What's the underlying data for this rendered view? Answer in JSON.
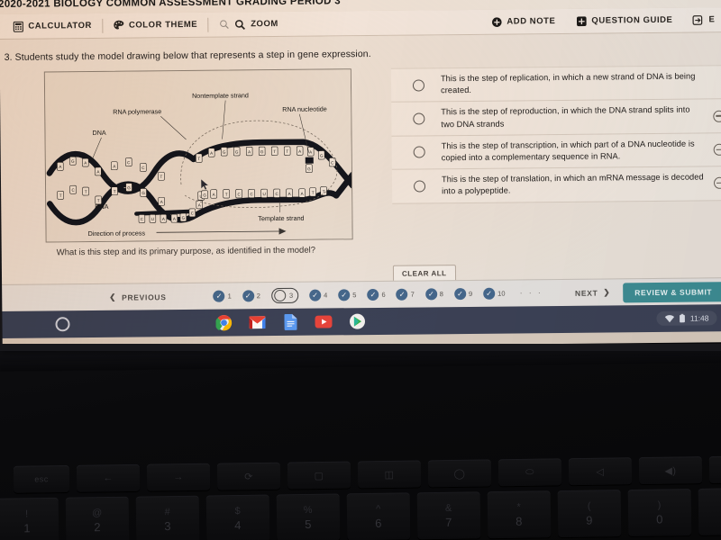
{
  "assessment": {
    "title": "2020-2021 BIOLOGY COMMON ASSESSMENT GRADING PERIOD 3"
  },
  "toolbar": {
    "left_items": [
      {
        "label": "CALCULATOR",
        "icon": "calculator-icon"
      },
      {
        "label": "COLOR THEME",
        "icon": "palette-icon"
      },
      {
        "label": "ZOOM",
        "icon": "magnifier-icon"
      }
    ],
    "right_items": [
      {
        "label": "ADD NOTE",
        "icon": "plus-circle-icon"
      },
      {
        "label": "QUESTION GUIDE",
        "icon": "guide-icon"
      },
      {
        "label": "E",
        "icon": "exit-icon"
      }
    ]
  },
  "question": {
    "prompt": "3. Students study the model drawing below that represents a step in gene expression.",
    "footer": "What is this step and its primary purpose, as identified in the model?",
    "clear_all_label": "CLEAR ALL"
  },
  "diagram": {
    "labels": {
      "rna_polymerase": "RNA polymerase",
      "nontemplate_strand": "Nontemplate strand",
      "rna_nucleotide": "RNA nucleotide",
      "dna": "DNA",
      "rna": "RNA",
      "template_strand": "Template strand",
      "direction": "Direction of process"
    },
    "top_strand_bases": [
      "T",
      "A",
      "G",
      "G",
      "A",
      "G",
      "T",
      "T",
      "A",
      "A",
      "G",
      "C",
      "A"
    ],
    "bottom_strand_bases": [
      "A",
      "T",
      "C",
      "C",
      "U",
      "C",
      "A",
      "A",
      "T",
      "T",
      "C",
      "G"
    ],
    "rna_bases": [
      "C",
      "U",
      "A",
      "A",
      "G",
      "C",
      "A",
      "G"
    ],
    "left_dna_bases": [
      "A",
      "G",
      "A",
      "A",
      "T",
      "C",
      "C",
      "T"
    ],
    "right_dna_bases": [
      "C",
      "G",
      "T",
      "A",
      "A"
    ]
  },
  "options": [
    {
      "text": "This is the step of replication, in which a new strand of DNA is being created.",
      "selected": false,
      "eliminated": false
    },
    {
      "text": "This is the step of reproduction, in which the DNA strand splits into two DNA strands",
      "selected": false,
      "eliminated": true
    },
    {
      "text": "This is the step of transcription, in which part of a DNA nucleotide is copied into a complementary sequence in RNA.",
      "selected": false,
      "eliminated": true
    },
    {
      "text": "This is the step of translation, in which an mRNA message is decoded into a polypeptide.",
      "selected": false,
      "eliminated": true
    }
  ],
  "nav": {
    "previous_label": "PREVIOUS",
    "next_label": "NEXT",
    "submit_label": "REVIEW & SUBMIT",
    "ellipsis": "· · ·",
    "questions": [
      {
        "number": "1",
        "state": "answered"
      },
      {
        "number": "2",
        "state": "answered"
      },
      {
        "number": "3",
        "state": "current"
      },
      {
        "number": "4",
        "state": "answered"
      },
      {
        "number": "5",
        "state": "answered"
      },
      {
        "number": "6",
        "state": "answered"
      },
      {
        "number": "7",
        "state": "answered"
      },
      {
        "number": "8",
        "state": "answered"
      },
      {
        "number": "9",
        "state": "answered"
      },
      {
        "number": "10",
        "state": "answered"
      }
    ]
  },
  "shelf": {
    "apps": [
      "chrome-icon",
      "gmail-icon",
      "docs-icon",
      "youtube-icon",
      "play-store-icon"
    ],
    "time": "11:48"
  },
  "keyboard": {
    "fn_row": [
      "esc",
      "←",
      "→",
      "⟳",
      "▢",
      "◫",
      "◯",
      "⬭",
      "◁",
      "◀)",
      "◀))"
    ],
    "num_row": [
      {
        "sym": "!",
        "num": "1"
      },
      {
        "sym": "@",
        "num": "2"
      },
      {
        "sym": "#",
        "num": "3"
      },
      {
        "sym": "$",
        "num": "4"
      },
      {
        "sym": "%",
        "num": "5"
      },
      {
        "sym": "^",
        "num": "6"
      },
      {
        "sym": "&",
        "num": "7"
      },
      {
        "sym": "*",
        "num": "8"
      },
      {
        "sym": "(",
        "num": "9"
      },
      {
        "sym": ")",
        "num": "0"
      },
      {
        "sym": "_",
        "num": "-"
      },
      {
        "sym": "+",
        "num": "="
      }
    ]
  },
  "colors": {
    "accent": "#3e8f96",
    "bubble": "#46698f",
    "shelf": "#3c4257"
  }
}
